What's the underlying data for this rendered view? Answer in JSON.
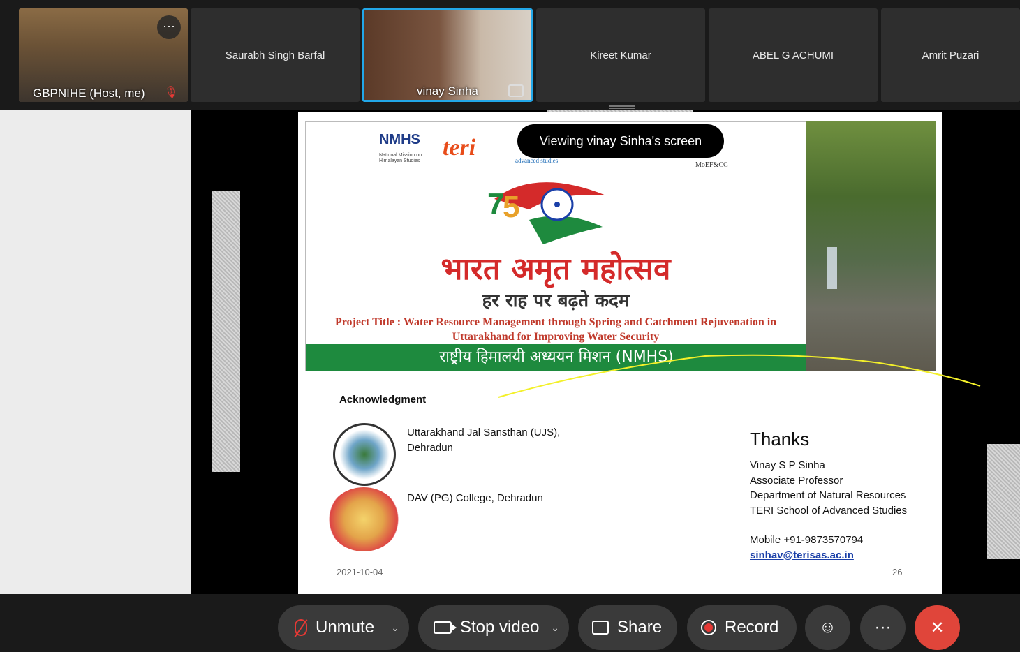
{
  "participants": [
    {
      "name": "GBPNIHE  (Host, me)",
      "video": true
    },
    {
      "name": "Saurabh Singh Barfal",
      "video": false
    },
    {
      "name": "vinay Sinha",
      "video": true,
      "active": true
    },
    {
      "name": "Kireet Kumar",
      "video": false
    },
    {
      "name": "ABEL G ACHUMI",
      "video": false
    },
    {
      "name": "Amrit Puzari",
      "video": false
    }
  ],
  "more_glyph": "···",
  "toast": "Viewing vinay Sinha's screen",
  "slide": {
    "logos": {
      "nmhs": "NMHS",
      "nmhs_sub": "National Mission on Himalayan Studies",
      "teri": "teri",
      "adv": "advanced studies",
      "moef": "MoEF&CC"
    },
    "hindi_title": "भारत अमृत महोत्सव",
    "hindi_subtitle": "हर राह पर बढ़ते कदम",
    "project_title": "Project Title : Water Resource Management through Spring and Catchment Rejuvenation in Uttarakhand for Improving Water Security",
    "green_bar": "राष्ट्रीय हिमालयी अध्ययन मिशन (NMHS)",
    "ack_title": "Acknowledgment",
    "ack_1": "Uttarakhand Jal Sansthan (UJS), Dehradun",
    "ack_2": "DAV (PG) College, Dehradun",
    "thanks": "Thanks",
    "contact": {
      "name": "Vinay S P Sinha",
      "role": "Associate Professor",
      "dept": "Department of Natural Resources",
      "school": "TERI School of Advanced Studies",
      "mobile": "Mobile +91-9873570794",
      "email": "sinhav@terisas.ac.in"
    },
    "date": "2021-10-04",
    "page": "26"
  },
  "toolbar": {
    "unmute": "Unmute",
    "stop_video": "Stop video",
    "share": "Share",
    "record": "Record",
    "more": "···",
    "end": "✕",
    "caret": "⌄"
  },
  "colors": {
    "accent": "#22a7e8",
    "end": "#e0453a",
    "annotation": "#f3f02a",
    "slide_green": "#1e8a3e",
    "slide_red": "#d42a2a"
  }
}
